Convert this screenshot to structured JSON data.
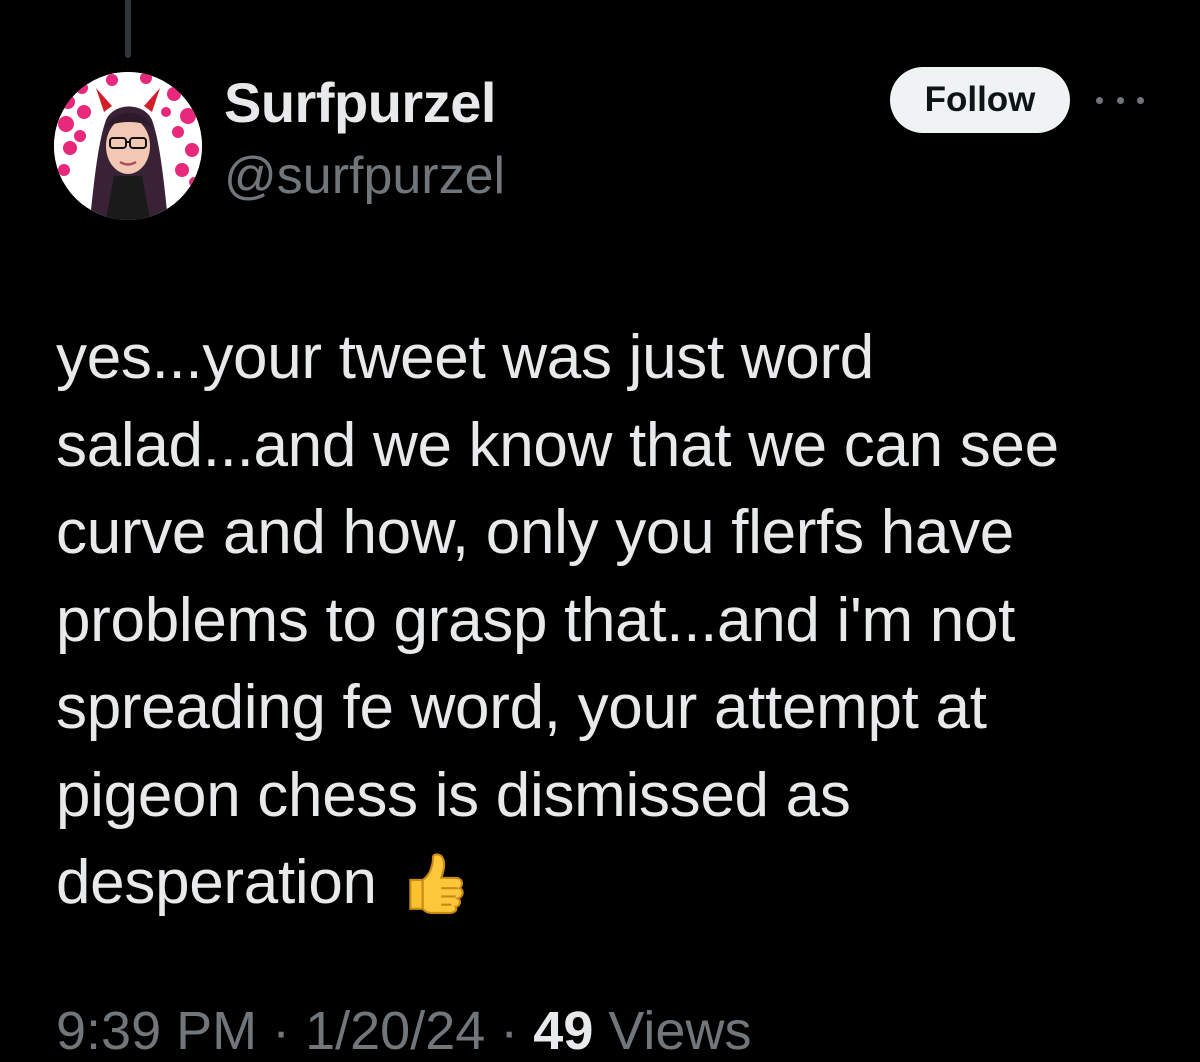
{
  "tweet": {
    "author": {
      "display_name": "Surfpurzel",
      "handle": "@surfpurzel",
      "avatar_icon": "profile-photo"
    },
    "follow_label": "Follow",
    "more_icon": "more-horizontal-icon",
    "text_lines": [
      "yes...your tweet was just word",
      "salad...and we know that we can see",
      "curve and how, only you flerfs have",
      "problems to grasp that...and i'm not",
      "spreading fe word, your attempt at",
      "pigeon chess is dismissed as",
      "desperation"
    ],
    "emoji": "thumbs-up",
    "meta": {
      "time": "9:39 PM",
      "date": "1/20/24",
      "views_count": "49",
      "views_label": "Views"
    }
  },
  "colors": {
    "background": "#000000",
    "text_primary": "#e7e9ea",
    "text_secondary": "#71767b",
    "follow_button_bg": "#eff3f4",
    "follow_button_text": "#0f1419"
  }
}
